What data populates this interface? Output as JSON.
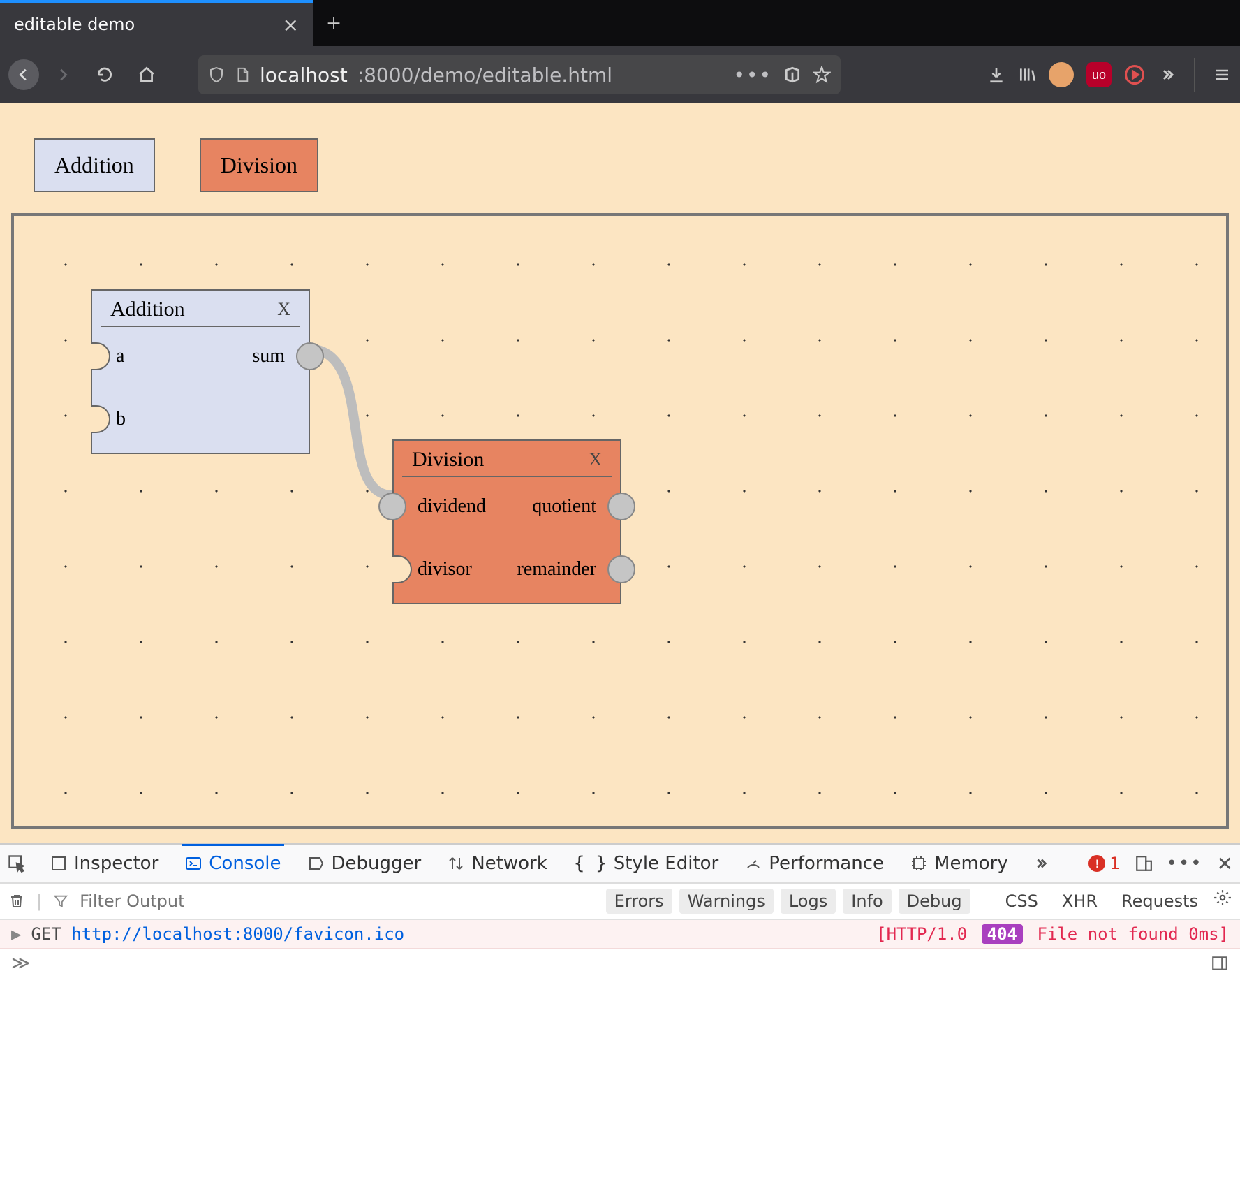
{
  "browser": {
    "tab_title": "editable demo",
    "url_host": "localhost",
    "url_port_path": ":8000/demo/editable.html"
  },
  "palette": {
    "addition_label": "Addition",
    "division_label": "Division"
  },
  "nodes": {
    "addition": {
      "title": "Addition",
      "close_glyph": "X",
      "in_a": "a",
      "in_b": "b",
      "out_sum": "sum"
    },
    "division": {
      "title": "Division",
      "close_glyph": "X",
      "in_dividend": "dividend",
      "in_divisor": "divisor",
      "out_quotient": "quotient",
      "out_remainder": "remainder"
    }
  },
  "devtools": {
    "tabs": {
      "inspector": "Inspector",
      "console": "Console",
      "debugger": "Debugger",
      "network": "Network",
      "style_editor": "Style Editor",
      "performance": "Performance",
      "memory": "Memory"
    },
    "filter_placeholder": "Filter Output",
    "error_count": "1",
    "level_toggles": {
      "errors": "Errors",
      "warnings": "Warnings",
      "logs": "Logs",
      "info": "Info",
      "debug": "Debug"
    },
    "extra_toggles": {
      "css": "CSS",
      "xhr": "XHR",
      "requests": "Requests"
    },
    "log": {
      "method": "GET",
      "url": "http://localhost:8000/favicon.ico",
      "http_prefix": "[HTTP/1.0",
      "code": "404",
      "tail": "File not found 0ms]"
    }
  }
}
